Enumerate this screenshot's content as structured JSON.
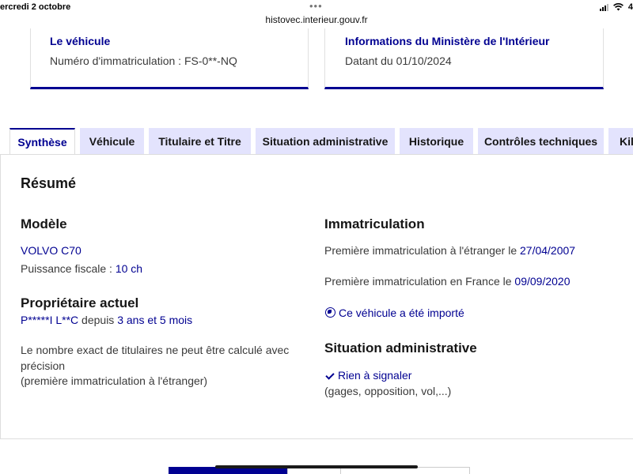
{
  "status_bar": {
    "date": "ercredi 2 octobre",
    "dots": "•••",
    "url": "histovec.interieur.gouv.fr",
    "battery": "4"
  },
  "cards": {
    "vehicle": {
      "title": "Le véhicule",
      "text": "Numéro d'immatriculation : FS-0**-NQ"
    },
    "ministry": {
      "title": "Informations du Ministère de l'Intérieur",
      "text": "Datant du 01/10/2024"
    }
  },
  "tabs": [
    {
      "label": "Synthèse",
      "active": true
    },
    {
      "label": "Véhicule",
      "active": false
    },
    {
      "label": "Titulaire et Titre",
      "active": false
    },
    {
      "label": "Situation administrative",
      "active": false
    },
    {
      "label": "Historique",
      "active": false
    },
    {
      "label": "Contrôles techniques",
      "active": false
    },
    {
      "label": "Kilo",
      "active": false
    }
  ],
  "summary": {
    "heading": "Résumé",
    "model": {
      "heading": "Modèle",
      "name": "VOLVO C70",
      "power_label": "Puissance fiscale : ",
      "power_value": "10 ch"
    },
    "owner": {
      "heading": "Propriétaire actuel",
      "name": "P*****I L**C",
      "since_label": " depuis ",
      "since_value": "3 ans et 5 mois",
      "note_line1": "Le nombre exact de titulaires ne peut être calculé avec",
      "note_line2": "précision",
      "note_line3": "(première immatriculation à l'étranger)"
    },
    "registration": {
      "heading": "Immatriculation",
      "foreign_label": "Première immatriculation à l'étranger le ",
      "foreign_date": "27/04/2007",
      "france_label": "Première immatriculation en France le ",
      "france_date": "09/09/2020",
      "imported_link": "Ce véhicule a été importé"
    },
    "admin": {
      "heading": "Situation administrative",
      "status": "Rien à signaler",
      "details": "(gages, opposition, vol,...)"
    }
  },
  "colors": {
    "primary": "#000091",
    "tab_bg": "#e3e3fd",
    "text": "#3a3a3a"
  },
  "icons": {
    "imported": "globe-icon",
    "status_ok": "check-icon",
    "signal": "signal-icon",
    "wifi": "wifi-icon"
  }
}
